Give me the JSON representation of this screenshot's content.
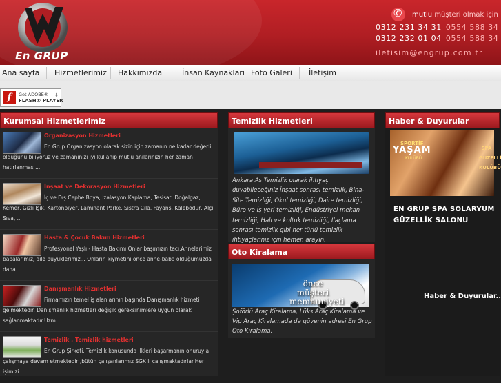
{
  "header": {
    "logo_text": "En GRUP",
    "motto_prefix": "mutlu",
    "motto_highlight": "müşteri olmak için",
    "phones": [
      {
        "primary": "0312 231 34 31",
        "mobile": "0554 588 34 34"
      },
      {
        "primary": "0312 232 01 04",
        "mobile": "0554 588 34 43"
      }
    ],
    "email": "iletisim@engrup.com.tr"
  },
  "nav": {
    "items": [
      "Ana sayfa",
      "Hizmetlerimiz",
      "Hakkımızda",
      "İnsan Kaynakları",
      "Foto Galeri",
      "İletişim"
    ]
  },
  "flash": {
    "line1": "Get ADOBE®",
    "line2": "FLASH® PLAYER"
  },
  "corporate": {
    "heading": "Kurumsal Hizmetlerimiz",
    "services": [
      {
        "title": "Organizasyon Hizmetleri",
        "text": "En Grup Organizasyon olarak sizin için zamanın ne kadar değerli olduğunu biliyoruz ve zamanınızı iyi kullanıp mutlu anılarınızın her zaman hatırlanmas ..."
      },
      {
        "title": "İnşaat ve Dekorasyon Hizmetleri",
        "text": "İç ve Dış Cephe Boya, İzalasyon Kaplama, Tesisat, Doğalgaz, Kemer, Gizli Işık, Kartonpiyer, Laminant Parke, Sistra Cila, Fayans, Kalebodur, Alçı Sıva, ..."
      },
      {
        "title": "Hasta & Çocuk Bakım Hizmetleri",
        "text": "Profesyonel Yaşlı - Hasta Bakımı.Onlar başımızın tacı.Annelerimiz babalarımız, aile büyüklerimiz... Onların kıymetini önce anne-baba olduğumuzda daha ..."
      },
      {
        "title": "Danışmanlık Hizmetleri",
        "text": "Firmamızın temel iş alanlarının başında Danışmanlık hizmeti gelmektedir. Danışmanlık hizmetleri değişik gereksinimlere uygun olarak sağlanmaktadır.Uzm ..."
      },
      {
        "title": "Temizlik , Temizlik hizmetleri",
        "text": "En Grup Şirketi, Temizlik konusunda ilkleri başarmanın onuruyla çalışmaya devam etmektedir ,bütün çalışanlarımız SGK lı çalışmaktadırlar.Her işimizi ..."
      }
    ]
  },
  "cleaning": {
    "heading": "Temizlik Hizmetleri",
    "text": "Ankara As Temizlik olarak ihtiyaç duyabileceğiniz İnşaat sonrası temizlik, Bina-Site Temizliği, Okul temizliği, Daire temizliği, Büro ve İş yeri temizliği, Endüstriyel mekan temizliği, Halı ve koltuk temizliği, İlaçlama sonrası temizlik gibi her türlü temizlik ihtiyaçlarınız için hemen arayın."
  },
  "rental": {
    "heading": "Oto Kiralama",
    "image_caption": "önce müşteri memnuniyeti",
    "text": "Şoförlü Araç Kiralama, Lüks Araç Kiralama ve Vip Araç Kiralamada da güvenin adresi En Grup Oto Kiralama."
  },
  "news": {
    "heading": "Haber & Duyurular",
    "banner_sport": "SPORTİF",
    "banner_title": "YAŞAM",
    "banner_sub": "KULÜBÜ",
    "banner_side": "SPA GÜZELLİK KULÜBÜ",
    "spa_caption": "EN GRUP SPA SOLARYUM GÜZELLİK SALONU",
    "more_link": "Haber & Duyurular...."
  },
  "colors": {
    "brand_red": "#c9262b",
    "panel_bg": "#262626",
    "page_bg": "#1e1e1e",
    "service_title": "#e23030"
  }
}
